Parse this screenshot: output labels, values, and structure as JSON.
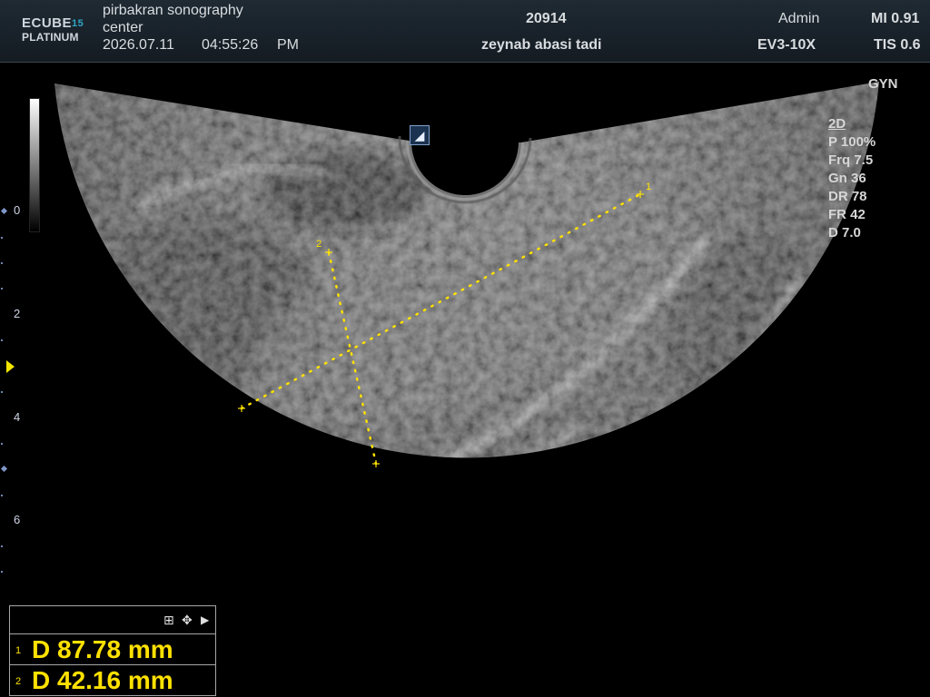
{
  "header": {
    "logo_top": "ECUBE",
    "logo_num": "15",
    "logo_bottom": "PLATINUM",
    "institution_line1": "pirbakran sonography",
    "institution_line2": "center",
    "date": "2026.07.11",
    "time": "04:55:26",
    "ampm": "PM",
    "patient_id": "20914",
    "patient_name": "zeynab abasi tadi",
    "user": "Admin",
    "probe": "EV3-10X",
    "mi": "MI 0.91",
    "tis": "TIS 0.6"
  },
  "preset": "GYN",
  "params": {
    "mode": "2D",
    "power": "P 100%",
    "frequency": "Frq 7.5",
    "gain": "Gn 36",
    "dynamic_range": "DR 78",
    "frame_rate": "FR 42",
    "depth": "D 7.0"
  },
  "depth_scale": {
    "labels": [
      "0",
      "2",
      "4",
      "6"
    ]
  },
  "probe_marker": "◢",
  "caliper_labels": [
    "1",
    "2"
  ],
  "toolbar": {
    "grid_icon": "⊞",
    "move_icon": "✥",
    "next_icon": "▶"
  },
  "measurements": [
    {
      "index": "1",
      "text": "D  87.78 mm"
    },
    {
      "index": "2",
      "text": "D  42.16 mm"
    }
  ],
  "colors": {
    "measurement": "#ffe100",
    "header_bg": "#1a232b",
    "scale_accent": "#6f86b5"
  }
}
